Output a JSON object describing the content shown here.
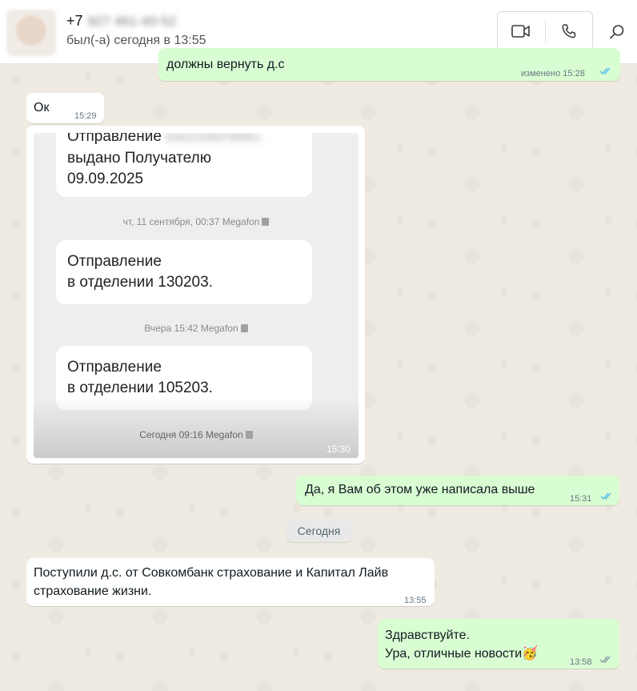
{
  "header": {
    "phone_prefix": "+7",
    "phone_hidden": "927 461-40-52",
    "status": "был(-а) сегодня в 13:55"
  },
  "messages": {
    "m0": {
      "text": "должны вернуть д.с",
      "time": "изменено 15:28"
    },
    "m1": {
      "text": "Ок",
      "time": "15:29"
    },
    "m2": {
      "time": "15:30",
      "screenshot": {
        "card1_line1": "Отправление",
        "card1_hidden": "ЕМ123456789RU",
        "card1_line2": "выдано Получателю",
        "card1_line3": "09.09.2025",
        "meta1": "чт, 11 сентября, 00:37  Megafon",
        "card2_line1": "Отправление",
        "card2_line2": "в отделении 130203.",
        "meta2": "Вчера 15:42  Megafon",
        "card3_line1": "Отправление",
        "card3_line2": "в отделении 105203.",
        "meta3": "Сегодня 09:16  Megafon"
      }
    },
    "m3": {
      "text": "Да, я Вам об этом уже написала выше",
      "time": "15:31"
    },
    "date_chip": "Сегодня",
    "m4": {
      "line1": "Поступили д.с. от Совкомбанк страхование и Капитал Лайв",
      "line2": "страхование жизни.",
      "time": "13:55"
    },
    "m5": {
      "line1": "Здравствуйте.",
      "line2": "Ура, отличные новости",
      "emoji": "🥳",
      "time": "13:58"
    }
  },
  "colors": {
    "outgoing": "#d9fdd3",
    "incoming": "#ffffff",
    "read_ticks": "#53bdeb",
    "sent_ticks": "#8696a0"
  }
}
